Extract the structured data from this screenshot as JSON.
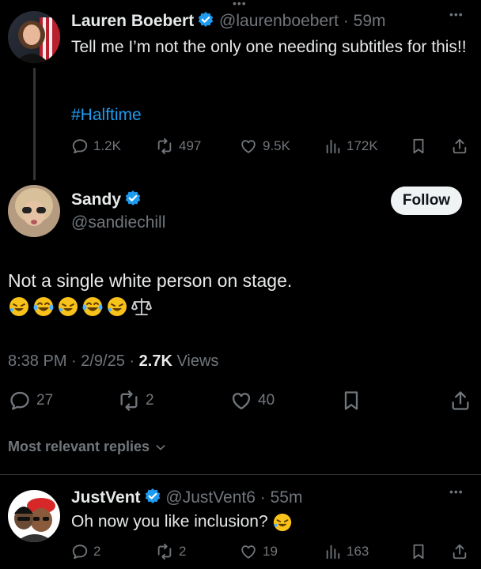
{
  "top_more": "•••",
  "tweet1": {
    "display_name": "Lauren Boebert",
    "handle": "@laurenboebert",
    "time": "· 59m",
    "text": "Tell me I’m not the only one needing subtitles for this!!",
    "hashtag": "#Halftime",
    "replies": "1.2K",
    "reposts": "497",
    "likes": "9.5K",
    "views": "172K"
  },
  "main": {
    "display_name": "Sandy",
    "handle": "@sandiechill",
    "follow_label": "Follow",
    "text": "Not a single white person on stage.",
    "emojis": [
      "rofl-emoji",
      "joy-emoji",
      "rofl-emoji",
      "joy-emoji",
      "rofl-emoji",
      "scales-emoji"
    ],
    "timestamp": "8:38 PM · 2/9/25 · ",
    "views_count": "2.7K",
    "views_label": " Views",
    "replies": "27",
    "reposts": "2",
    "likes": "40"
  },
  "sort_label": "Most relevant replies",
  "reply": {
    "display_name": "JustVent",
    "handle": "@JustVent6",
    "time": "· 55m",
    "text": "Oh now you like inclusion?",
    "replies": "2",
    "reposts": "2",
    "likes": "19",
    "views": "163",
    "more": "•••"
  },
  "colors": {
    "verified": "#1d9bf0",
    "hashtag": "#1d9bf0",
    "background": "#000000"
  }
}
